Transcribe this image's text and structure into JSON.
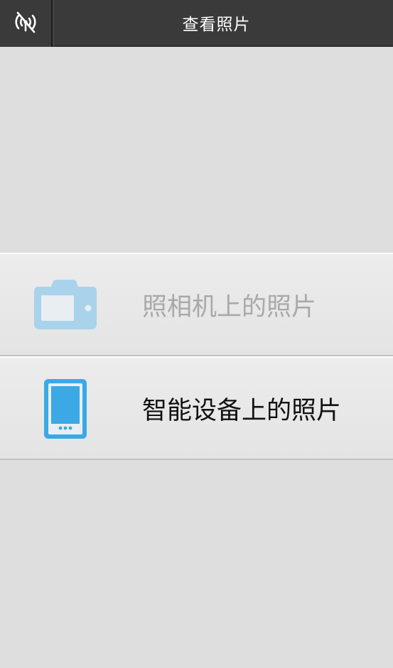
{
  "header": {
    "title": "查看照片",
    "connection_icon": "wireless-off-icon"
  },
  "menu": {
    "items": [
      {
        "label": "照相机上的照片",
        "icon": "camera-icon",
        "enabled": false,
        "icon_color": "#a9d3ea"
      },
      {
        "label": "智能设备上的照片",
        "icon": "smartphone-icon",
        "enabled": true,
        "icon_color": "#3aa9e6"
      }
    ]
  },
  "colors": {
    "topbar": "#3a3a3a",
    "background": "#dedede",
    "title_text": "#ffffff"
  }
}
